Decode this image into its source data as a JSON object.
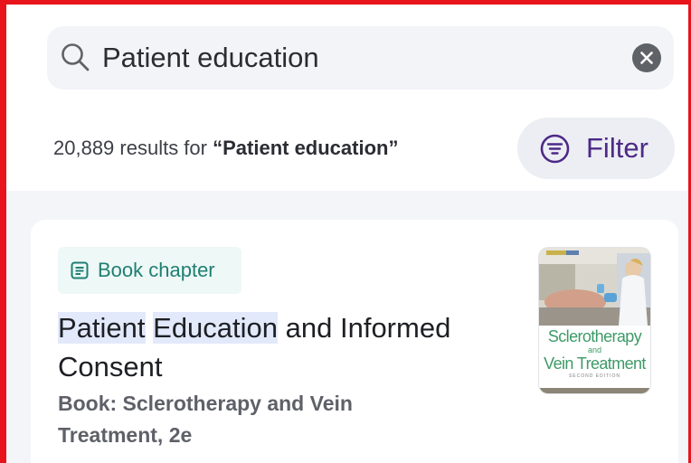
{
  "search": {
    "query": "Patient education"
  },
  "results": {
    "prefix": "20,889 results for ",
    "query_quoted": "“Patient education”"
  },
  "filter": {
    "label": "Filter"
  },
  "card": {
    "type_label": "Book chapter",
    "title_hl1": "Patient",
    "title_space1": " ",
    "title_hl2": "Education",
    "title_rest": " and Informed Consent",
    "source": "Book: Sclerotherapy and Vein Treatment, 2e",
    "cover": {
      "line1": "Sclerotherapy",
      "and": "and",
      "line2": "Vein Treatment",
      "edition": "SECOND EDITION"
    }
  },
  "colors": {
    "accent": "#4d2a86",
    "badge_text": "#1f7f73",
    "highlight": "#e2e9fb",
    "frame": "#e8141b"
  },
  "icons": {
    "search": "search-icon",
    "clear": "clear-icon",
    "filter": "filter-icon",
    "book": "book-chapter-icon"
  }
}
